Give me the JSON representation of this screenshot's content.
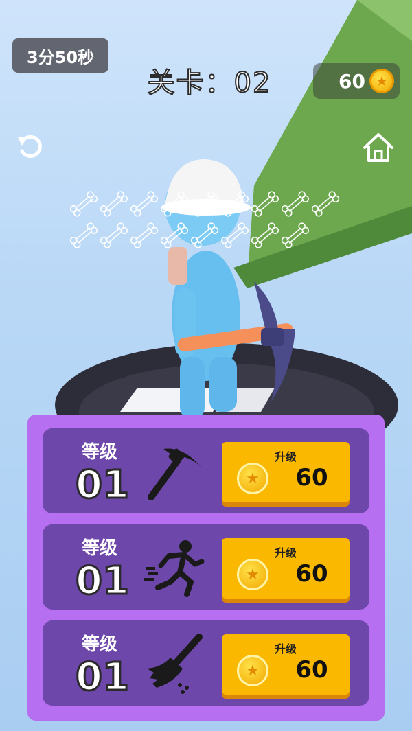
{
  "hud": {
    "timer": "3分50秒",
    "level_title": "关卡：02",
    "coins": "60"
  },
  "icons": {
    "undo": "undo-icon",
    "home": "home-icon",
    "coin": "coin-icon"
  },
  "bones": {
    "total": 17,
    "collected": 0
  },
  "upgrades": [
    {
      "level_label": "等级",
      "level": "01",
      "icon": "pickaxe-icon",
      "button_label": "升级",
      "price": "60"
    },
    {
      "level_label": "等级",
      "level": "01",
      "icon": "running-man-icon",
      "button_label": "升级",
      "price": "60"
    },
    {
      "level_label": "等级",
      "level": "01",
      "icon": "broom-icon",
      "button_label": "升级",
      "price": "60"
    }
  ],
  "colors": {
    "panel": "#b66ff0",
    "row": "#6e47ab",
    "button": "#fbb800",
    "coin": "#f2a800"
  }
}
